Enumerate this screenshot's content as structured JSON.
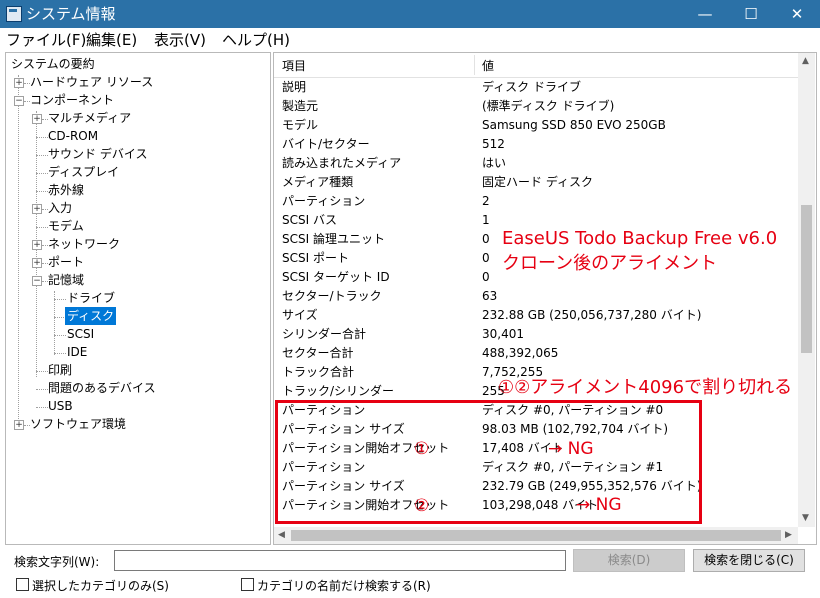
{
  "window": {
    "title": "システム情報",
    "minimize_glyph": "—",
    "maximize_glyph": "☐",
    "close_glyph": "✕"
  },
  "menu": [
    "ファイル(F)",
    "編集(E)",
    "表示(V)",
    "ヘルプ(H)"
  ],
  "tree": {
    "root": "システムの要約",
    "items": [
      "ハードウェア リソース",
      "コンポーネント",
      "マルチメディア",
      "CD-ROM",
      "サウンド デバイス",
      "ディスプレイ",
      "赤外線",
      "入力",
      "モデム",
      "ネットワーク",
      "ポート",
      "記憶域",
      "ドライブ",
      "ディスク",
      "SCSI",
      "IDE",
      "印刷",
      "問題のあるデバイス",
      "USB",
      "ソフトウェア環境"
    ],
    "selected": "ディスク"
  },
  "list": {
    "columns": [
      "項目",
      "値"
    ],
    "rows": [
      [
        "説明",
        "ディスク ドライブ"
      ],
      [
        "製造元",
        "(標準ディスク ドライブ)"
      ],
      [
        "モデル",
        "Samsung SSD 850 EVO 250GB"
      ],
      [
        "バイト/セクター",
        "512"
      ],
      [
        "読み込まれたメディア",
        "はい"
      ],
      [
        "メディア種類",
        "固定ハード ディスク"
      ],
      [
        "パーティション",
        "2"
      ],
      [
        "SCSI バス",
        "1"
      ],
      [
        "SCSI 論理ユニット",
        "0"
      ],
      [
        "SCSI ポート",
        "0"
      ],
      [
        "SCSI ターゲット ID",
        "0"
      ],
      [
        "セクター/トラック",
        "63"
      ],
      [
        "サイズ",
        "232.88 GB (250,056,737,280 バイト)"
      ],
      [
        "シリンダー合計",
        "30,401"
      ],
      [
        "セクター合計",
        "488,392,065"
      ],
      [
        "トラック合計",
        "7,752,255"
      ],
      [
        "トラック/シリンダー",
        "255"
      ],
      [
        "パーティション",
        "ディスク #0, パーティション #0"
      ],
      [
        "パーティション サイズ",
        "98.03 MB (102,792,704 バイト)"
      ],
      [
        "パーティション開始オフセット",
        "17,408 バイト"
      ],
      [
        "パーティション",
        "ディスク #0, パーティション #1"
      ],
      [
        "パーティション サイズ",
        "232.79 GB (249,955,352,576 バイト)"
      ],
      [
        "パーティション開始オフセット",
        "103,298,048 バイト"
      ]
    ]
  },
  "annotations": {
    "title_line1": "EaseUS Todo Backup Free v6.0",
    "title_line2": "クローン後のアライメント",
    "alignment_note": "①②アライメント4096で割り切れる",
    "marker1": "①",
    "marker2": "②",
    "ng1": "→ NG",
    "ng2": "→ NG",
    "color": "#e60012"
  },
  "bottom": {
    "search_label": "検索文字列(W):",
    "search_value": "",
    "find_button": "検索(D)",
    "close_search_button": "検索を閉じる(C)",
    "checkbox1_label": "選択したカテゴリのみ(S)",
    "checkbox2_label": "カテゴリの名前だけ検索する(R)"
  }
}
